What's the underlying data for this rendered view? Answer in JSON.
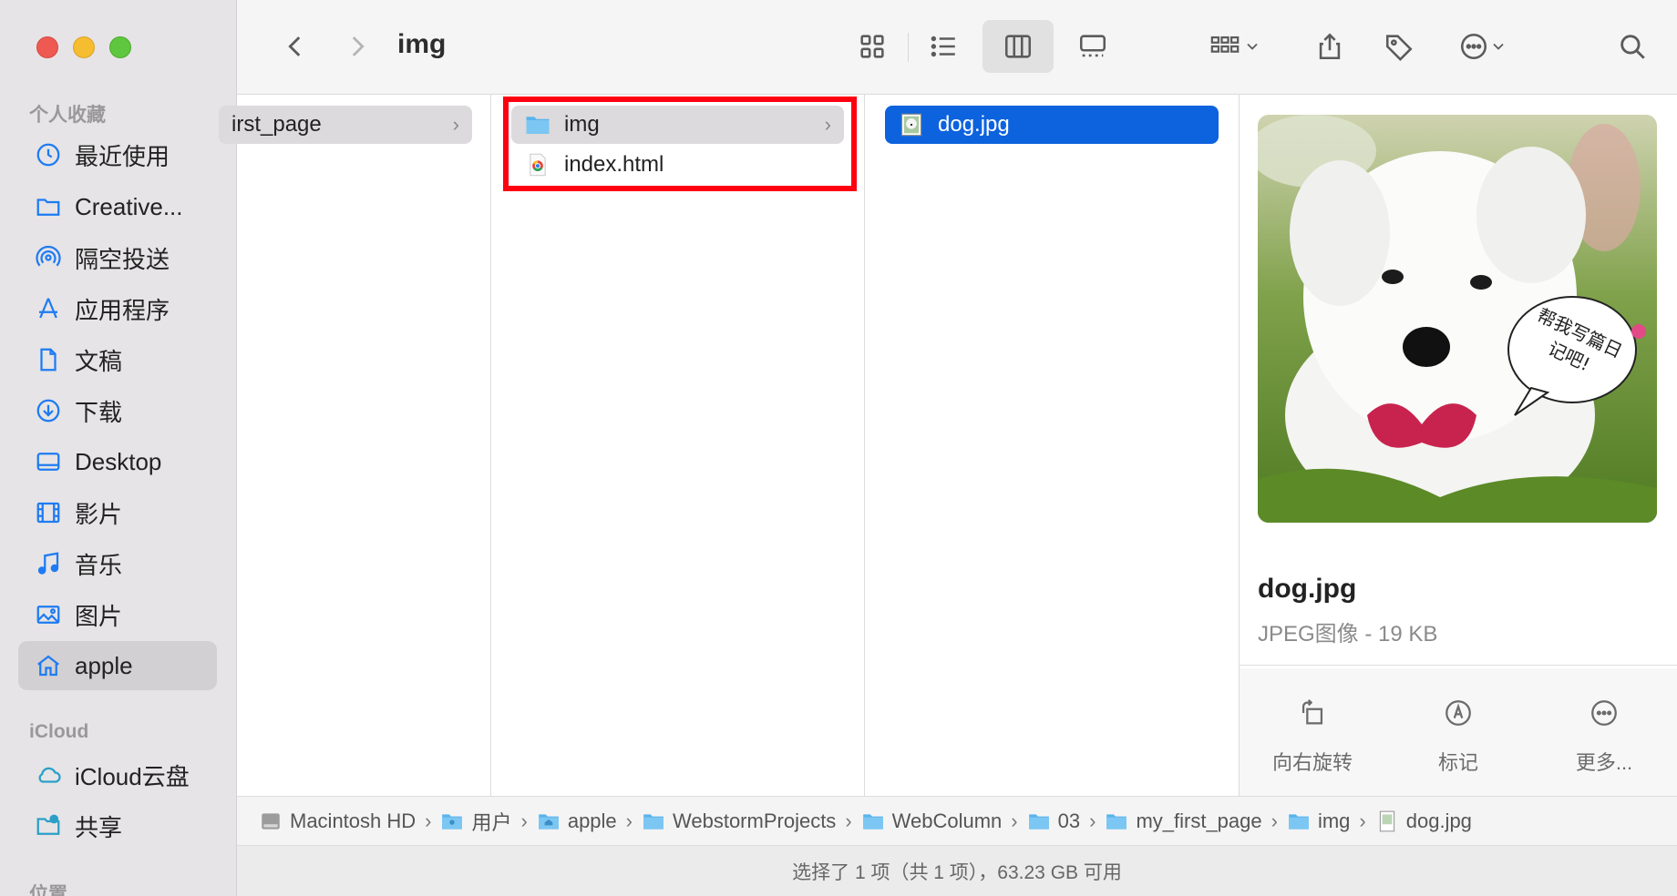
{
  "window": {
    "title": "img"
  },
  "sidebar": {
    "section_favorites": "个人收藏",
    "favorites": [
      {
        "label": "最近使用",
        "icon": "clock-icon"
      },
      {
        "label": "Creative...",
        "icon": "folder-icon"
      },
      {
        "label": "隔空投送",
        "icon": "airdrop-icon"
      },
      {
        "label": "应用程序",
        "icon": "applications-icon"
      },
      {
        "label": "文稿",
        "icon": "document-icon"
      },
      {
        "label": "下载",
        "icon": "download-icon"
      },
      {
        "label": "Desktop",
        "icon": "desktop-icon"
      },
      {
        "label": "影片",
        "icon": "film-icon"
      },
      {
        "label": "音乐",
        "icon": "music-icon"
      },
      {
        "label": "图片",
        "icon": "photo-icon"
      },
      {
        "label": "apple",
        "icon": "home-icon",
        "active": true
      }
    ],
    "section_icloud": "iCloud",
    "icloud": [
      {
        "label": "iCloud云盘",
        "icon": "cloud-icon"
      },
      {
        "label": "共享",
        "icon": "shared-folder-icon"
      }
    ],
    "section_locations": "位置"
  },
  "columns": {
    "col1": [
      {
        "label": "irst_page",
        "selected": "gray"
      }
    ],
    "col2": [
      {
        "label": "img",
        "selected": "gray",
        "type": "folder"
      },
      {
        "label": "index.html",
        "type": "html"
      }
    ],
    "col3": [
      {
        "label": "dog.jpg",
        "selected": "blue",
        "type": "image"
      }
    ]
  },
  "preview": {
    "name": "dog.jpg",
    "meta": "JPEG图像 - 19 KB",
    "speech_text": "帮我写篇日记吧!",
    "actions": [
      {
        "label": "向右旋转",
        "icon": "rotate-right-icon"
      },
      {
        "label": "标记",
        "icon": "markup-icon"
      },
      {
        "label": "更多...",
        "icon": "more-icon"
      }
    ]
  },
  "pathbar": [
    {
      "label": "Macintosh HD",
      "icon": "disk-icon"
    },
    {
      "label": "用户",
      "icon": "folder-icon"
    },
    {
      "label": "apple",
      "icon": "home-folder-icon"
    },
    {
      "label": "WebstormProjects",
      "icon": "folder-icon"
    },
    {
      "label": "WebColumn",
      "icon": "folder-icon"
    },
    {
      "label": "03",
      "icon": "folder-icon"
    },
    {
      "label": "my_first_page",
      "icon": "folder-icon"
    },
    {
      "label": "img",
      "icon": "folder-icon"
    },
    {
      "label": "dog.jpg",
      "icon": "image-file-icon"
    }
  ],
  "status": "选择了 1 项（共 1 项），63.23 GB 可用",
  "colors": {
    "accent": "#0d63de",
    "highlight_box": "#ff0010",
    "folder": "#5ab4ec"
  }
}
